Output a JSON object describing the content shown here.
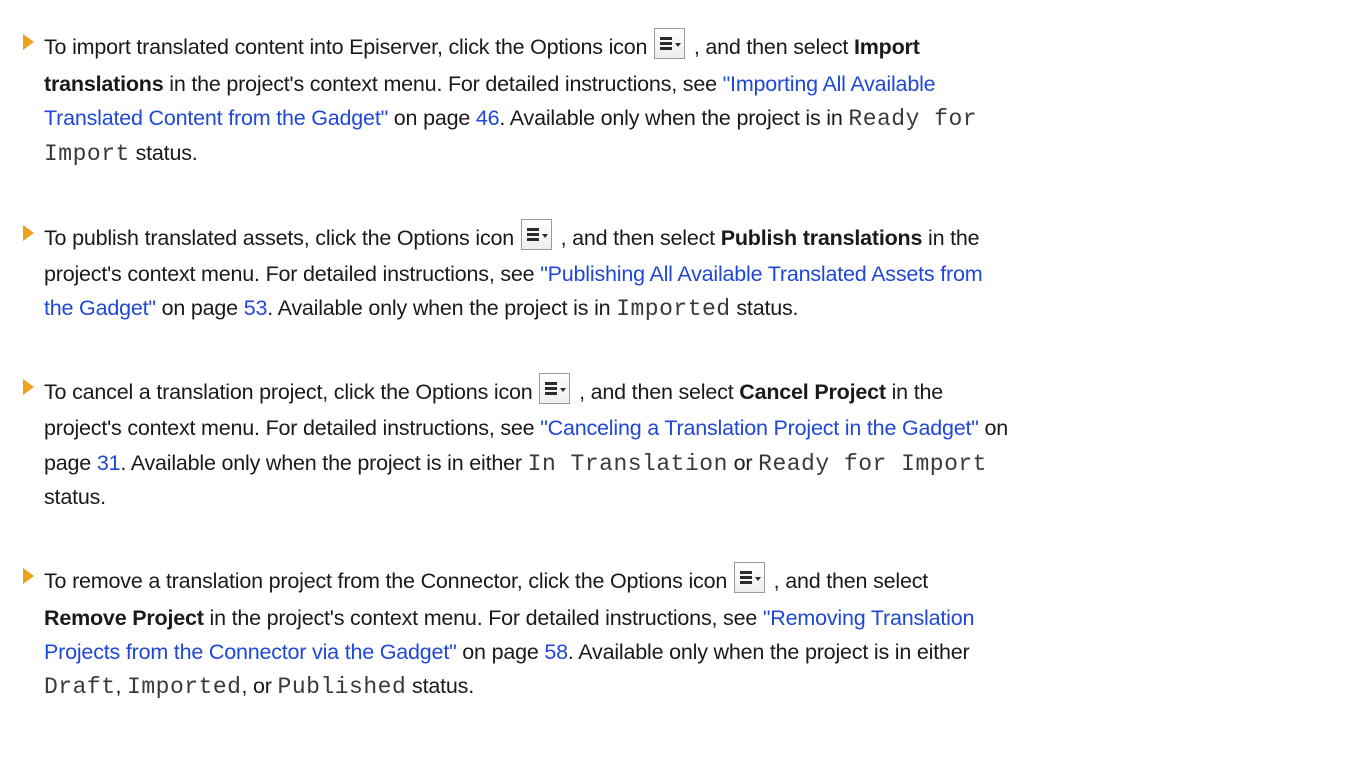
{
  "colors": {
    "bullet": "#f0a01c",
    "link": "#1f47d8",
    "text": "#1a1a1a"
  },
  "icons": {
    "options": "options-menu-icon",
    "bullet": "orange-triangle-bullet"
  },
  "items": [
    {
      "l1_a": "To import translated content into Episerver, click the Options icon",
      "l1_b": ", and then select",
      "l1_c": "Import",
      "l2_a": "translations",
      "l2_b": " in the project's context menu. For detailed instructions, see ",
      "l2_link": "\"Importing All Available",
      "l3_link": "Translated Content from the Gadget\"",
      "l3_a": " on page ",
      "l3_page": "46",
      "l3_b": ". Available only when the project is in ",
      "l3_code": "Ready for",
      "l4_code": "Import",
      "l4_a": " status."
    },
    {
      "l1_a": "To publish translated assets, click the Options icon",
      "l1_b": ", and then select ",
      "l1_c": "Publish translations",
      "l1_d": " in the",
      "l2_a": "project's context menu. For detailed instructions, see ",
      "l2_link": "\"Publishing All Available Translated Assets from",
      "l3_link": "the Gadget\"",
      "l3_a": " on page ",
      "l3_page": "53",
      "l3_b": ". Available only when the project is in ",
      "l3_code": "Imported",
      "l3_c": " status."
    },
    {
      "l1_a": "To cancel a translation project, click the Options icon",
      "l1_b": ", and then select ",
      "l1_c": "Cancel Project",
      "l1_d": " in the",
      "l2_a": "project's context menu. For detailed instructions, see ",
      "l2_link": "\"Canceling a Translation Project in the Gadget\"",
      "l2_b": " on",
      "l3_a": "page ",
      "l3_page": "31",
      "l3_b": ". Available only when the project is in either ",
      "l3_code1": "In Translation",
      "l3_c": " or ",
      "l3_code2": "Ready for Import",
      "l4_a": "status."
    },
    {
      "l1_a": "To remove a translation project from the Connector, click the Options icon",
      "l1_b": ", and then select",
      "l2_a": "Remove Project",
      "l2_b": " in the project's context menu. For detailed instructions, see ",
      "l2_link": "\"Removing Translation",
      "l3_link": "Projects from the Connector via the Gadget\"",
      "l3_a": " on page ",
      "l3_page": "58",
      "l3_b": ". Available only when the project is in either",
      "l4_code1": "Draft",
      "l4_a": ", ",
      "l4_code2": "Imported",
      "l4_b": ", or ",
      "l4_code3": "Published",
      "l4_c": " status."
    }
  ]
}
